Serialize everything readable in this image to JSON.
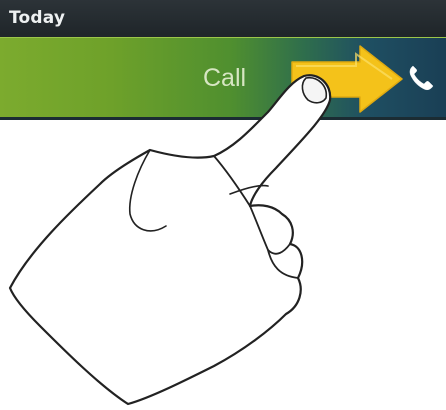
{
  "header": {
    "title": "Today"
  },
  "incoming_call": {
    "label": "Call",
    "accept_icon": "phone-icon",
    "gesture_hint": "swipe-right-arrow"
  },
  "colors": {
    "header_bg": "#2c3338",
    "strip_green": "#7cab2e",
    "strip_teal": "#1a3f55",
    "arrow": "#f4c21a",
    "hand_outline": "#222222"
  }
}
